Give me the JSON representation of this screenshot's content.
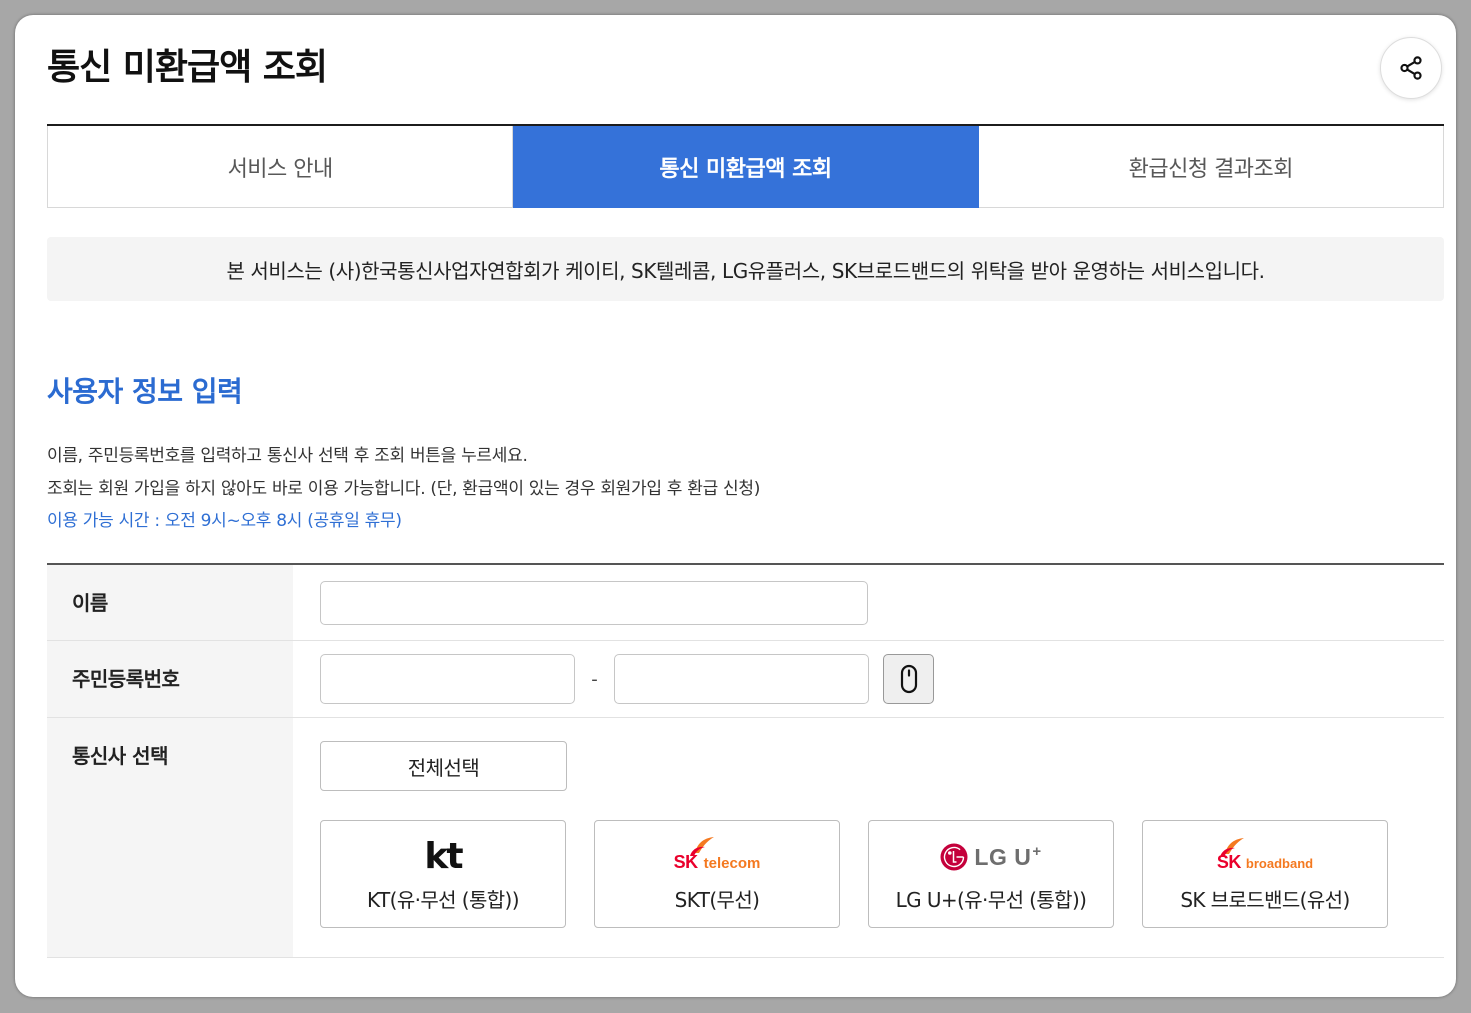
{
  "page": {
    "title": "통신 미환급액 조회"
  },
  "share_button": {
    "icon": "share-icon"
  },
  "tabs": [
    {
      "label": "서비스 안내",
      "active": false
    },
    {
      "label": "통신 미환급액 조회",
      "active": true
    },
    {
      "label": "환급신청 결과조회",
      "active": false
    }
  ],
  "notice": {
    "text": "본 서비스는 (사)한국통신사업자연합회가 케이티, SK텔레콤, LG유플러스, SK브로드밴드의 위탁을 받아 운영하는 서비스입니다."
  },
  "user_info": {
    "heading": "사용자 정보 입력",
    "instructions": [
      "이름, 주민등록번호를 입력하고 통신사 선택 후 조회 버튼을 누르세요.",
      "조회는 회원 가입을 하지 않아도 바로 이용 가능합니다. (단, 환급액이 있는 경우 회원가입 후 환급 신청)"
    ],
    "hours": "이용 가능 시간 : 오전 9시~오후 8시 (공휴일 휴무)"
  },
  "form": {
    "name": {
      "label": "이름",
      "value": ""
    },
    "resident_number": {
      "label": "주민등록번호",
      "front_value": "",
      "separator": "-",
      "back_value": "",
      "input_button_icon": "mouse-icon"
    },
    "carrier": {
      "label": "통신사 선택",
      "select_all_label": "전체선택",
      "options": [
        {
          "label": "KT(유·무선 (통합))",
          "logo": {
            "text": "kt"
          }
        },
        {
          "label": "SKT(무선)",
          "logo": {
            "icon": "sk-butterfly-icon",
            "brand": "SK",
            "sub": "telecom"
          }
        },
        {
          "label": "LG U+(유·무선 (통합))",
          "logo": {
            "icon": "lg-face-icon",
            "brand": "LG U",
            "mark": "+"
          }
        },
        {
          "label": "SK 브로드밴드(유선)",
          "logo": {
            "icon": "sk-butterfly-icon",
            "brand": "SK",
            "sub": "broadband"
          }
        }
      ]
    }
  },
  "colors": {
    "accent": "#3572d9",
    "heading": "#2b6bd1",
    "hours_text": "#2f6fd4",
    "sk_red": "#ea002c",
    "sk_orange": "#f47920",
    "lg_red": "#c4003b",
    "frame": "#a7a7a7"
  }
}
